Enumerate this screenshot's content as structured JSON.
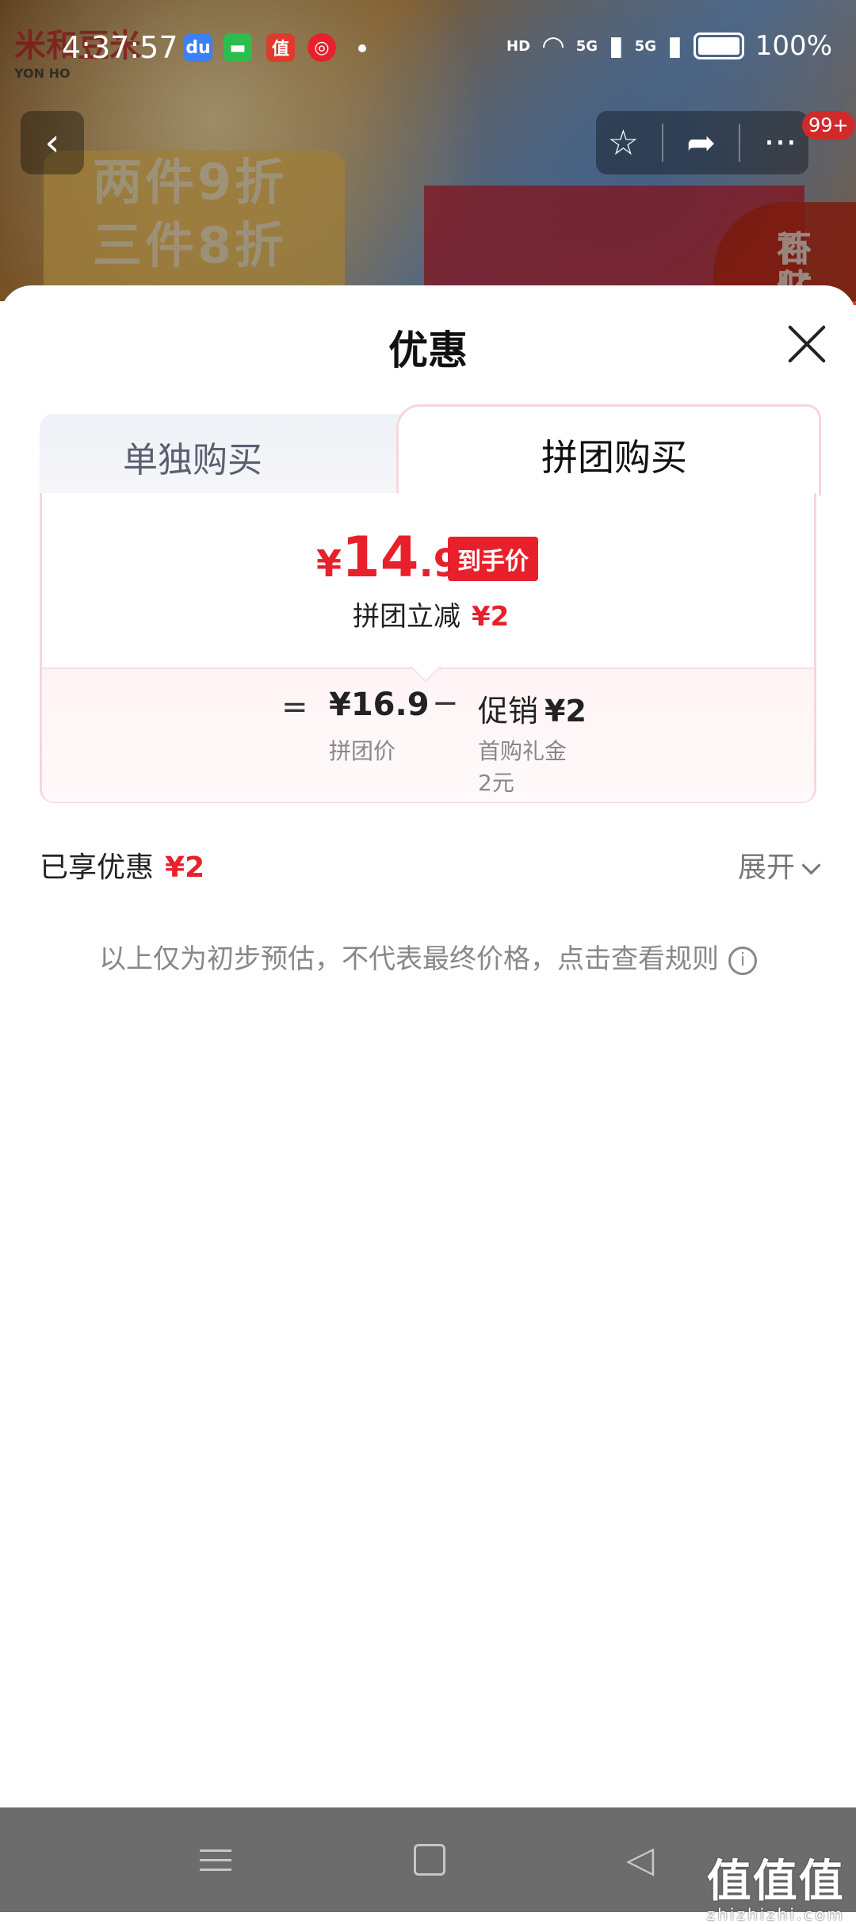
{
  "status_bar": {
    "time": "4:37:57",
    "hd": "HD",
    "net1": "5G",
    "net2": "5G",
    "battery": "100%",
    "app_icons": [
      "baidu-icon",
      "message-icon",
      "zhi-icon",
      "netease-music-icon"
    ]
  },
  "background": {
    "brand_name": "米和豆米",
    "brand_sub": "YON HO",
    "promo_line1": "两件9折",
    "promo_line2": "三件8折",
    "badge_line1": "百亿",
    "badge_line2": "补贴"
  },
  "nav": {
    "badge": "99+"
  },
  "sheet": {
    "title": "优惠",
    "tabs": [
      {
        "label": "单独购买",
        "active": false
      },
      {
        "label": "拼团购买",
        "active": true
      }
    ],
    "price": {
      "currency": "¥",
      "integer": "14",
      "decimal": ".9",
      "tag": "到手价"
    },
    "group_save": {
      "label": "拼团立减",
      "amount": "¥2"
    },
    "breakdown": {
      "equals": "=",
      "base_value": "¥16.9",
      "base_label": "拼团价",
      "minus": "−",
      "promo_label": "促销",
      "promo_value": "¥2",
      "promo_detail1": "首购礼金",
      "promo_detail2": "2元"
    },
    "enjoyed": {
      "label": "已享优惠",
      "amount": "¥2"
    },
    "expand_label": "展开",
    "disclaimer": "以上仅为初步预估，不代表最终价格，点击查看规则"
  },
  "watermark": {
    "main": "值值值",
    "sub": "zhizhizhi.com"
  },
  "colors": {
    "accent_red": "#e8202c",
    "tab_border": "#f6d7dc",
    "navbar": "#6c6c6c"
  }
}
